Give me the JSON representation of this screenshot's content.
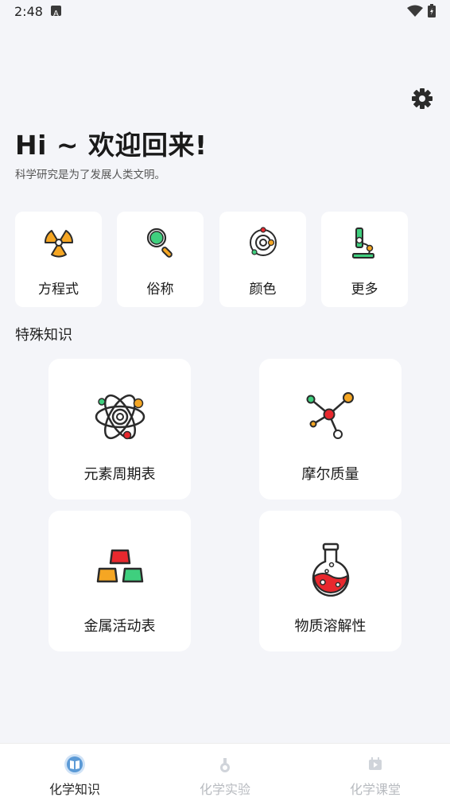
{
  "status_bar": {
    "time": "2:48"
  },
  "header": {
    "greeting": "Hi ~ 欢迎回来!",
    "subtitle": "科学研究是为了发展人类文明。"
  },
  "quick_actions": [
    {
      "label": "方程式",
      "icon": "radiation-icon"
    },
    {
      "label": "俗称",
      "icon": "magnifier-icon"
    },
    {
      "label": "颜色",
      "icon": "orbit-icon"
    },
    {
      "label": "更多",
      "icon": "microscope-icon"
    }
  ],
  "section": {
    "title": "特殊知识"
  },
  "cards": [
    {
      "label": "元素周期表",
      "icon": "atom-icon"
    },
    {
      "label": "摩尔质量",
      "icon": "molecule-icon"
    },
    {
      "label": "金属活动表",
      "icon": "blocks-icon"
    },
    {
      "label": "物质溶解性",
      "icon": "flask-icon"
    }
  ],
  "bottom_nav": [
    {
      "label": "化学知识",
      "active": true
    },
    {
      "label": "化学实验",
      "active": false
    },
    {
      "label": "化学课堂",
      "active": false
    }
  ],
  "colors": {
    "background": "#f4f5f9",
    "accent": "#5b9ad6",
    "inactive": "#c0c3c8",
    "orange": "#f5a623",
    "red": "#e8282e",
    "green": "#3fcf7e"
  }
}
